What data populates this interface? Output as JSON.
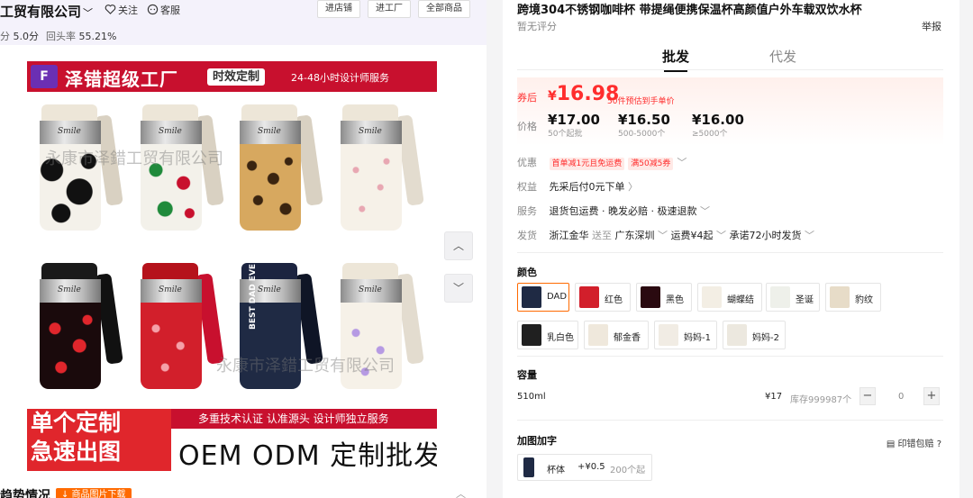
{
  "shop": {
    "name": "工贸有限公司",
    "follow": "关注",
    "service": "客服",
    "score_label": "分",
    "score": "5.0分",
    "repurchase_label": "回头率",
    "repurchase": "55.21%",
    "buttons": [
      "进店铺",
      "进工厂",
      "全部商品"
    ]
  },
  "image": {
    "banner_logo": "F",
    "banner_title": "泽错超级工厂",
    "banner_badge": "时效定制",
    "banner_sub": "24-48小时设计师服务",
    "cup_brand": "Smile",
    "watermark_top": "永康市泽錯工贸有限公司",
    "watermark_bottom": "永康市泽錯工贸有限公司",
    "bottom_left_1": "单个定制",
    "bottom_left_2": "急速出图",
    "bottom_strip": "多重技术认证 认准源头 设计师独立服务",
    "bottom_big": "OEM ODM 定制批发",
    "navy_cup_text": "BEST DAD EVER"
  },
  "footer": {
    "title": "趋势情况",
    "tag": "↓ 商品图片下载"
  },
  "product": {
    "title": "跨境304不锈钢咖啡杯 带提绳便携保温杯高颜值户外车载双饮水杯",
    "rating": "暂无评分",
    "report": "举报",
    "tabs": [
      "批发",
      "代发"
    ]
  },
  "price": {
    "coupon_label": "券后",
    "coupon_currency": "¥",
    "coupon_price": "16.98",
    "coupon_note": "50件预估到手单价",
    "label": "价格",
    "tiers": [
      {
        "price": "¥17.00",
        "cond": "50个起批"
      },
      {
        "price": "¥16.50",
        "cond": "500-5000个"
      },
      {
        "price": "¥16.00",
        "cond": "≥5000个"
      }
    ]
  },
  "rows": {
    "promo_label": "优惠",
    "promo_tags": [
      "首单减1元且免运费",
      "满50减5券"
    ],
    "rights_label": "权益",
    "rights_value": "先采后付0元下单",
    "service_label": "服务",
    "service_value": "退货包运费 · 晚发必赔 · 极速退款",
    "ship_label": "发货",
    "ship_from": "浙江金华",
    "ship_to_word": "送至",
    "ship_to": "广东深圳",
    "ship_fee": "运费¥4起",
    "ship_promise": "承诺72小时发货"
  },
  "colors": {
    "title": "颜色",
    "options": [
      {
        "label": "DAD",
        "body": "#1f2a44"
      },
      {
        "label": "红色",
        "body": "#d21f2b"
      },
      {
        "label": "黑色",
        "body": "#2a0a10"
      },
      {
        "label": "蝴蝶结",
        "body": "#f3eee4"
      },
      {
        "label": "圣诞",
        "body": "#eef0ea"
      },
      {
        "label": "豹纹",
        "body": "#e7dcc8"
      },
      {
        "label": "乳白色",
        "body": "#202020"
      },
      {
        "label": "郁金香",
        "body": "#efe8dc"
      },
      {
        "label": "妈妈-1",
        "body": "#f1ece4"
      },
      {
        "label": "妈妈-2",
        "body": "#ece8df"
      }
    ]
  },
  "capacity": {
    "title": "容量",
    "size": "510ml",
    "price": "¥17",
    "stock": "库存999987个",
    "minus": "−",
    "qty": "0",
    "plus": "+"
  },
  "addon": {
    "title": "加图加字",
    "right": "印错包赔",
    "item_label": "杯体",
    "item_price": "+¥0.5",
    "item_min": "200个起"
  },
  "colors_theme": {
    "accent": "#ff6a00",
    "price_red": "#ff2d2d",
    "banner_red": "#c8102e"
  }
}
